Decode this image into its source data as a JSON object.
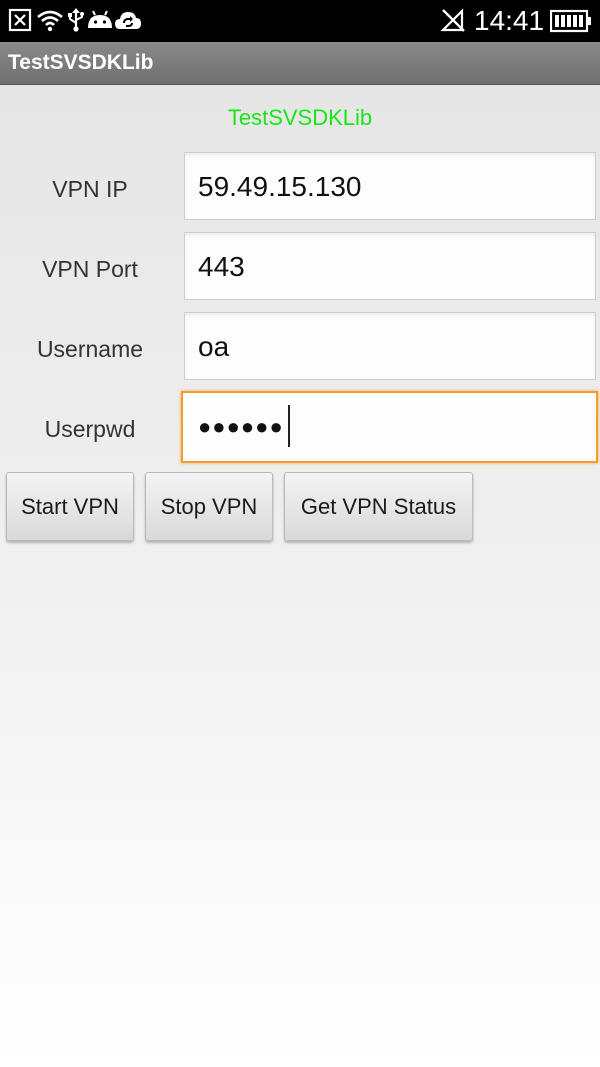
{
  "status_bar": {
    "time": "14:41",
    "icons": [
      "close-box-icon",
      "wifi-icon",
      "usb-icon",
      "android-icon",
      "sync-cloud-icon",
      "signal-muted-icon",
      "battery-icon"
    ],
    "color": "#000000"
  },
  "app_bar": {
    "title": "TestSVSDKLib"
  },
  "main": {
    "heading": "TestSVSDKLib",
    "heading_color": "#19e619",
    "fields": {
      "vpn_ip": {
        "label": "VPN IP",
        "value": "59.49.15.130"
      },
      "vpn_port": {
        "label": "VPN Port",
        "value": "443"
      },
      "username": {
        "label": "Username",
        "value": "oa"
      },
      "userpwd": {
        "label": "Userpwd",
        "value": "●●●●●●"
      }
    },
    "focus_color": "#f39c2a",
    "buttons": {
      "start": "Start VPN",
      "stop": "Stop VPN",
      "status": "Get VPN Status"
    }
  }
}
